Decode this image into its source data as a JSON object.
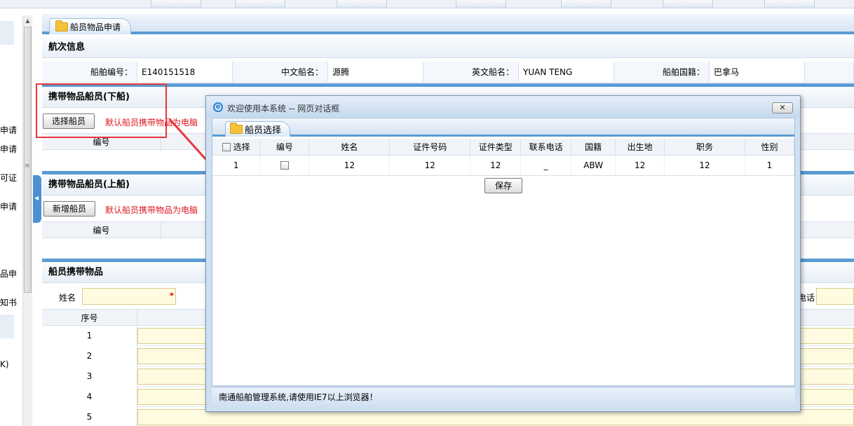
{
  "sidebar": {
    "items": [
      "申请",
      "申请",
      "可证",
      "申请",
      "品申",
      "知书",
      "K)"
    ]
  },
  "main": {
    "tab_label": "船员物品申请",
    "voyage": {
      "heading": "航次信息",
      "fields": [
        {
          "label": "船舶编号：",
          "value": "E140151518"
        },
        {
          "label": "中文船名：",
          "value": "源腾"
        },
        {
          "label": "英文船名：",
          "value": "YUAN TENG"
        },
        {
          "label": "船舶国籍：",
          "value": "巴拿马"
        }
      ]
    },
    "disembark": {
      "heading": "携带物品船员(下船)",
      "button": "选择船员",
      "note": "默认船员携带物品为电脑",
      "col_no": "编号"
    },
    "embark": {
      "heading": "携带物品船员(上船)",
      "button": "新增船员",
      "note": "默认船员携带物品为电脑",
      "col_no": "编号"
    },
    "items": {
      "heading": "船员携带物品",
      "name_label": "姓名",
      "required_mark": "*",
      "phone_label_partial": "电话",
      "seq_header": "序号",
      "rows": [
        "1",
        "2",
        "3",
        "4",
        "5"
      ]
    }
  },
  "dialog": {
    "title": "欢迎使用本系统 -- 网页对话框",
    "close": "✕",
    "tab_label": "船员选择",
    "columns": [
      "选择",
      "编号",
      "姓名",
      "证件号码",
      "证件类型",
      "联系电话",
      "国籍",
      "出生地",
      "职务",
      "性别"
    ],
    "rows": [
      {
        "select": "1",
        "no": "",
        "name": "12",
        "id_no": "12",
        "id_type": "12",
        "phone": "_",
        "nationality": "ABW",
        "birthplace": "12",
        "position": "12",
        "gender": "1"
      }
    ],
    "save": "保存",
    "footer": "南通船舶管理系统,请使用IE7以上浏览器！"
  },
  "colors": {
    "accent": "#5a9bd5",
    "annotation": "#e8363c",
    "note": "#e0141e",
    "input_fill": "#fffbe0"
  }
}
